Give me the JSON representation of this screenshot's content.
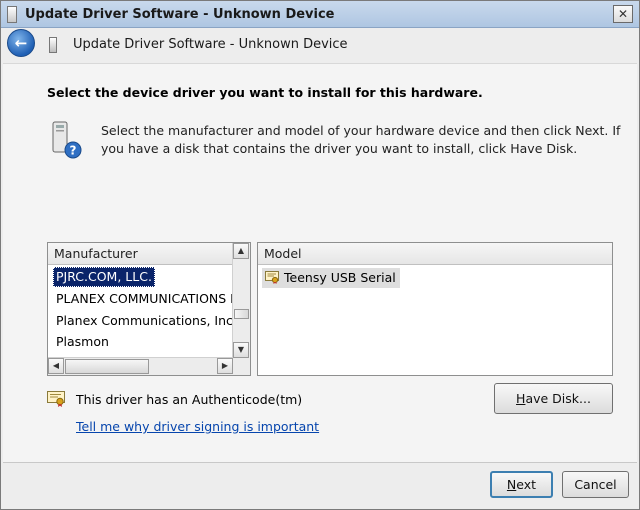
{
  "window": {
    "title": "Update Driver Software - Unknown Device",
    "close_glyph": "✕"
  },
  "nav": {
    "back_glyph": "←",
    "title": "Update Driver Software - Unknown Device"
  },
  "heading": "Select the device driver you want to install for this hardware.",
  "description": "Select the manufacturer and model of your hardware device and then click Next. If you have a disk that contains the driver you want to install, click Have Disk.",
  "manufacturer_list": {
    "header": "Manufacturer",
    "items": [
      "PJRC.COM, LLC.",
      "PLANEX COMMUNICATIONS I",
      "Planex Communications, Inc.",
      "Plasmon"
    ],
    "selected": "PJRC.COM, LLC."
  },
  "model_list": {
    "header": "Model",
    "items": [
      "Teensy USB Serial"
    ]
  },
  "signing": {
    "status_text": "This driver has an Authenticode(tm)",
    "link_text": "Tell me why driver signing is important"
  },
  "buttons": {
    "have_disk_first": "H",
    "have_disk_rest": "ave Disk...",
    "next_first": "N",
    "next_rest": "ext",
    "cancel": "Cancel"
  },
  "scroll_glyphs": {
    "up": "▲",
    "down": "▼",
    "left": "◀",
    "right": "▶"
  },
  "colors": {
    "selection": "#0a246a",
    "link": "#0645ad",
    "default_button_border": "#3c7fb1"
  }
}
